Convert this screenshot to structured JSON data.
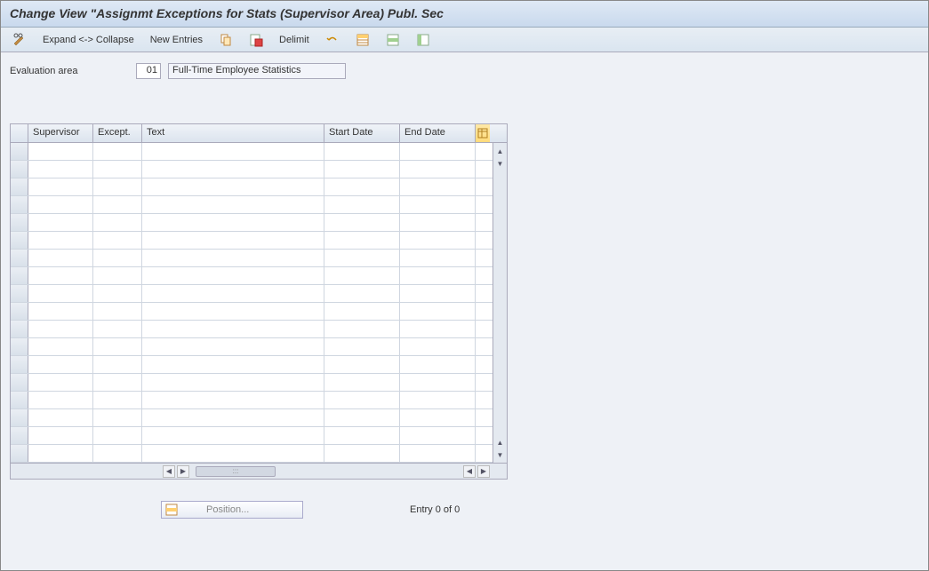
{
  "title": "Change View \"Assignmt Exceptions for Stats (Supervisor Area) Publ. Sec",
  "toolbar": {
    "expand_collapse": "Expand <-> Collapse",
    "new_entries": "New Entries",
    "delimit": "Delimit"
  },
  "fields": {
    "evaluation_area_label": "Evaluation area",
    "evaluation_area_code": "01",
    "evaluation_area_desc": "Full-Time Employee Statistics"
  },
  "table": {
    "headers": {
      "supervisor": "Supervisor",
      "except": "Except.",
      "text": "Text",
      "start_date": "Start Date",
      "end_date": "End Date"
    },
    "rows": [
      {
        "supervisor": "",
        "except": "",
        "text": "",
        "start_date": "",
        "end_date": ""
      },
      {
        "supervisor": "",
        "except": "",
        "text": "",
        "start_date": "",
        "end_date": ""
      },
      {
        "supervisor": "",
        "except": "",
        "text": "",
        "start_date": "",
        "end_date": ""
      },
      {
        "supervisor": "",
        "except": "",
        "text": "",
        "start_date": "",
        "end_date": ""
      },
      {
        "supervisor": "",
        "except": "",
        "text": "",
        "start_date": "",
        "end_date": ""
      },
      {
        "supervisor": "",
        "except": "",
        "text": "",
        "start_date": "",
        "end_date": ""
      },
      {
        "supervisor": "",
        "except": "",
        "text": "",
        "start_date": "",
        "end_date": ""
      },
      {
        "supervisor": "",
        "except": "",
        "text": "",
        "start_date": "",
        "end_date": ""
      },
      {
        "supervisor": "",
        "except": "",
        "text": "",
        "start_date": "",
        "end_date": ""
      },
      {
        "supervisor": "",
        "except": "",
        "text": "",
        "start_date": "",
        "end_date": ""
      },
      {
        "supervisor": "",
        "except": "",
        "text": "",
        "start_date": "",
        "end_date": ""
      },
      {
        "supervisor": "",
        "except": "",
        "text": "",
        "start_date": "",
        "end_date": ""
      },
      {
        "supervisor": "",
        "except": "",
        "text": "",
        "start_date": "",
        "end_date": ""
      },
      {
        "supervisor": "",
        "except": "",
        "text": "",
        "start_date": "",
        "end_date": ""
      },
      {
        "supervisor": "",
        "except": "",
        "text": "",
        "start_date": "",
        "end_date": ""
      },
      {
        "supervisor": "",
        "except": "",
        "text": "",
        "start_date": "",
        "end_date": ""
      },
      {
        "supervisor": "",
        "except": "",
        "text": "",
        "start_date": "",
        "end_date": ""
      },
      {
        "supervisor": "",
        "except": "",
        "text": "",
        "start_date": "",
        "end_date": ""
      }
    ]
  },
  "footer": {
    "position_label": "Position...",
    "entry_text": "Entry 0 of 0"
  }
}
